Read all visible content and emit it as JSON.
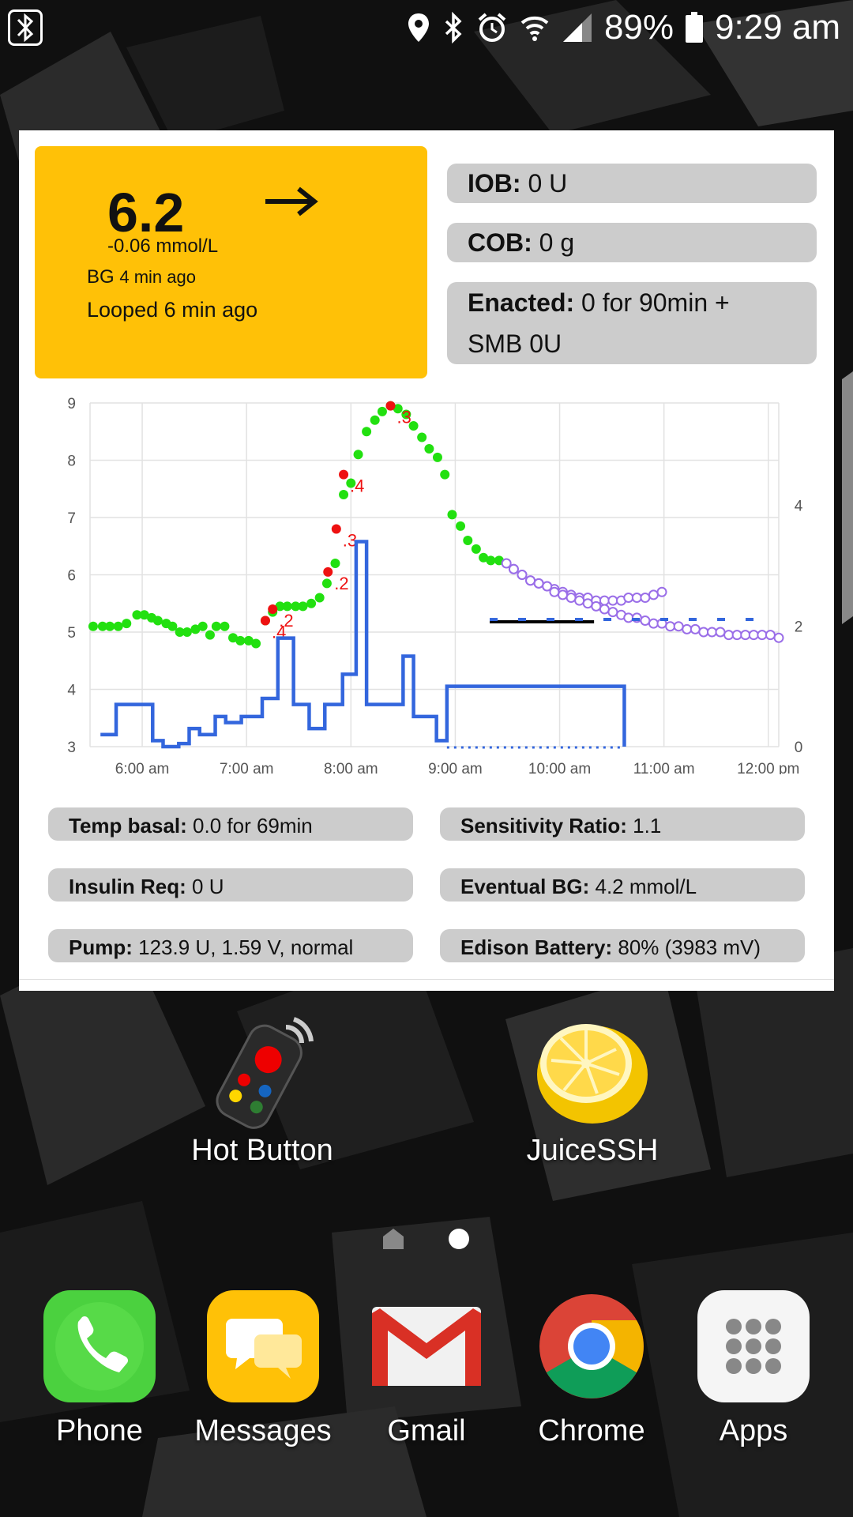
{
  "status": {
    "battery": "89%",
    "time": "9:29 am"
  },
  "bg": {
    "value": "6.2",
    "trend_arrow": "→",
    "delta": "-0.06 mmol/L",
    "age_prefix": "BG",
    "age": "4 min ago",
    "looped": "Looped 6 min ago"
  },
  "top_pills": {
    "iob_label": "IOB:",
    "iob_value": "0 U",
    "cob_label": "COB:",
    "cob_value": "0 g",
    "enacted_label": "Enacted:",
    "enacted_value": "0 for 90min +",
    "enacted_value2": "SMB 0U"
  },
  "stats": {
    "temp_basal_label": "Temp basal:",
    "temp_basal_value": "0.0 for 69min",
    "sensitivity_label": "Sensitivity Ratio:",
    "sensitivity_value": "1.1",
    "insulin_req_label": "Insulin Req:",
    "insulin_req_value": "0 U",
    "eventual_bg_label": "Eventual BG:",
    "eventual_bg_value": "4.2 mmol/L",
    "pump_label": "Pump:",
    "pump_value": "123.9 U, 1.59 V, normal",
    "battery_label": "Edison Battery:",
    "battery_value": "80% (3983 mV)"
  },
  "chart_data": {
    "type": "line",
    "x_tick_labels": [
      "6:00 am",
      "7:00 am",
      "8:00 am",
      "9:00 am",
      "10:00 am",
      "11:00 am",
      "12:00 pm"
    ],
    "y_left_ticks": [
      "9",
      "8",
      "7",
      "6",
      "5",
      "4",
      "3"
    ],
    "y_right_ticks": [
      "4",
      "2",
      "0"
    ],
    "ylim": [
      3,
      9
    ],
    "y2lim": [
      0,
      5.7
    ],
    "xlim": [
      5.5,
      12.1
    ],
    "grid": true,
    "series": [
      {
        "kind": "bg",
        "x": [
          5.53,
          5.62,
          5.69,
          5.77,
          5.85,
          5.95,
          6.02,
          6.09,
          6.15,
          6.23,
          6.29,
          6.36,
          6.43,
          6.51,
          6.58,
          6.65,
          6.71,
          6.79,
          6.87,
          6.94,
          7.02,
          7.09,
          7.18,
          7.25,
          7.32,
          7.39,
          7.47,
          7.54,
          7.62,
          7.7,
          7.77,
          7.85,
          7.93,
          8.0,
          8.07,
          8.15,
          8.23,
          8.3,
          8.38,
          8.45,
          8.53,
          8.6,
          8.68,
          8.75,
          8.83,
          8.9,
          8.97,
          9.05,
          9.12,
          9.2,
          9.27,
          9.34,
          9.42
        ],
        "values": [
          5.1,
          5.1,
          5.1,
          5.1,
          5.15,
          5.3,
          5.3,
          5.25,
          5.2,
          5.15,
          5.1,
          5.0,
          5.0,
          5.05,
          5.1,
          4.95,
          5.1,
          5.1,
          4.9,
          4.85,
          4.85,
          4.8,
          5.2,
          5.35,
          5.45,
          5.45,
          5.45,
          5.45,
          5.5,
          5.6,
          5.85,
          6.2,
          7.4,
          7.6,
          8.1,
          8.5,
          8.7,
          8.85,
          8.95,
          8.9,
          8.8,
          8.6,
          8.4,
          8.2,
          8.05,
          7.75,
          7.05,
          6.85,
          6.6,
          6.45,
          6.3,
          6.25,
          6.25
        ],
        "color": "#22e010",
        "smb_markers": [
          {
            "x": 7.18,
            "value": 5.2,
            "label": ".4"
          },
          {
            "x": 7.25,
            "value": 5.4,
            "label": ".2"
          },
          {
            "x": 7.78,
            "value": 6.05,
            "label": ".2"
          },
          {
            "x": 7.86,
            "value": 6.8,
            "label": ".3"
          },
          {
            "x": 7.93,
            "value": 7.75,
            "label": ".4"
          },
          {
            "x": 8.38,
            "value": 8.95,
            "label": ".3"
          }
        ],
        "smb_color": "#ee1111"
      },
      {
        "kind": "prediction",
        "x": [
          9.49,
          9.56,
          9.64,
          9.72,
          9.8,
          9.88,
          9.95,
          10.03,
          10.11,
          10.19,
          10.27,
          10.35,
          10.43,
          10.51,
          10.59,
          10.66,
          10.74,
          10.82,
          10.9,
          10.98
        ],
        "values": [
          6.2,
          6.1,
          6.0,
          5.9,
          5.85,
          5.8,
          5.75,
          5.7,
          5.65,
          5.6,
          5.6,
          5.55,
          5.55,
          5.55,
          5.55,
          5.6,
          5.6,
          5.6,
          5.65,
          5.7
        ],
        "color": "#9a6ee8"
      },
      {
        "kind": "prediction",
        "x": [
          9.56,
          9.64,
          9.72,
          9.8,
          9.88,
          9.95,
          10.03,
          10.11,
          10.19,
          10.27,
          10.35,
          10.43,
          10.51,
          10.59,
          10.66,
          10.74,
          10.82,
          10.9,
          10.98,
          11.06,
          11.14,
          11.22,
          11.3,
          11.38,
          11.46,
          11.54,
          11.62,
          11.7,
          11.78,
          11.86,
          11.94,
          12.02,
          12.1
        ],
        "values": [
          6.1,
          6.0,
          5.9,
          5.85,
          5.8,
          5.7,
          5.65,
          5.6,
          5.55,
          5.5,
          5.45,
          5.4,
          5.35,
          5.3,
          5.25,
          5.25,
          5.2,
          5.15,
          5.15,
          5.1,
          5.1,
          5.05,
          5.05,
          5.0,
          5.0,
          5.0,
          4.95,
          4.95,
          4.95,
          4.95,
          4.95,
          4.95,
          4.9
        ],
        "color": "#9a6ee8"
      },
      {
        "kind": "temp_target",
        "x": [
          9.33,
          10.33
        ],
        "values": [
          5.18,
          5.18
        ],
        "color": "#000000"
      },
      {
        "kind": "scheduled_basal_dashed",
        "x": [
          9.33,
          12.05
        ],
        "values": [
          5.22,
          5.22
        ],
        "color": "#3366dd"
      },
      {
        "kind": "basal_rate",
        "axis": "right",
        "x": [
          5.6,
          5.75,
          5.95,
          6.1,
          6.2,
          6.35,
          6.45,
          6.55,
          6.7,
          6.8,
          6.95,
          7.15,
          7.3,
          7.45,
          7.6,
          7.75,
          7.92,
          8.05,
          8.15,
          8.4,
          8.5,
          8.6,
          8.82,
          8.92,
          10.62
        ],
        "values": [
          0.2,
          0.7,
          0.7,
          0.1,
          0.0,
          0.05,
          0.3,
          0.2,
          0.5,
          0.4,
          0.5,
          0.8,
          1.8,
          0.7,
          0.3,
          0.7,
          1.2,
          3.4,
          0.7,
          0.7,
          1.5,
          0.5,
          0.1,
          1.0,
          0.0
        ],
        "color": "#3366dd"
      }
    ]
  },
  "home": {
    "apps": [
      {
        "label": "Hot Button"
      },
      {
        "label": "JuiceSSH"
      }
    ],
    "dock": [
      {
        "label": "Phone"
      },
      {
        "label": "Messages"
      },
      {
        "label": "Gmail"
      },
      {
        "label": "Chrome"
      },
      {
        "label": "Apps"
      }
    ]
  }
}
